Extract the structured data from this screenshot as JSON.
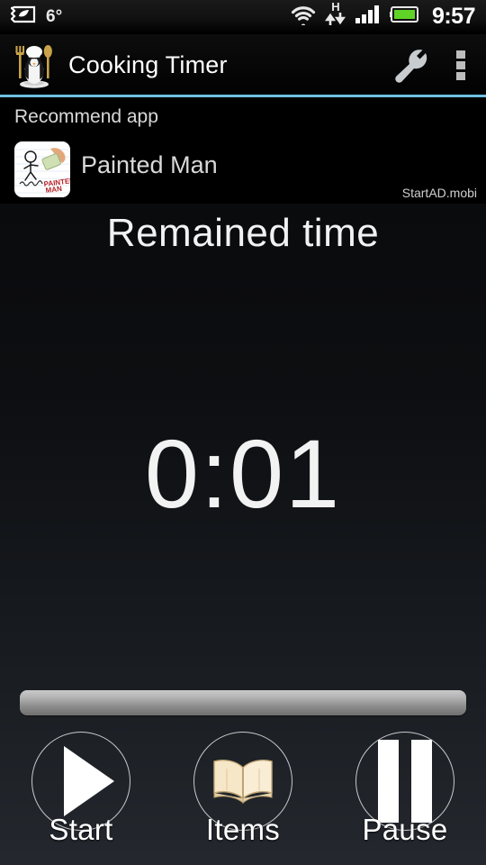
{
  "status_bar": {
    "eco_icon": "eco-leaf-icon",
    "temperature": "6°",
    "wifi_icon": "wifi-icon",
    "network_type": "H",
    "data_arrows_icon": "data-transfer-arrows-icon",
    "signal_icon": "cellular-signal-icon",
    "battery_icon": "battery-icon",
    "clock": "9:57"
  },
  "action_bar": {
    "app_icon": "penguin-chef-icon",
    "title": "Cooking Timer",
    "settings_icon": "wrench-icon",
    "overflow_icon": "overflow-menu-icon",
    "accent_color": "#6dc0e2"
  },
  "ad_banner": {
    "heading": "Recommend app",
    "app_icon": "painted-man-app-icon",
    "app_name": "Painted Man",
    "attribution": "StartAD.mobi"
  },
  "main": {
    "label": "Remained time",
    "timer": "0:01",
    "progress": {
      "percent": 0,
      "fill_color": "#8e8e8e"
    },
    "controls": [
      {
        "id": "start",
        "label": "Start",
        "icon": "play-icon"
      },
      {
        "id": "items",
        "label": "Items",
        "icon": "open-book-icon"
      },
      {
        "id": "pause",
        "label": "Pause",
        "icon": "pause-icon"
      }
    ]
  }
}
